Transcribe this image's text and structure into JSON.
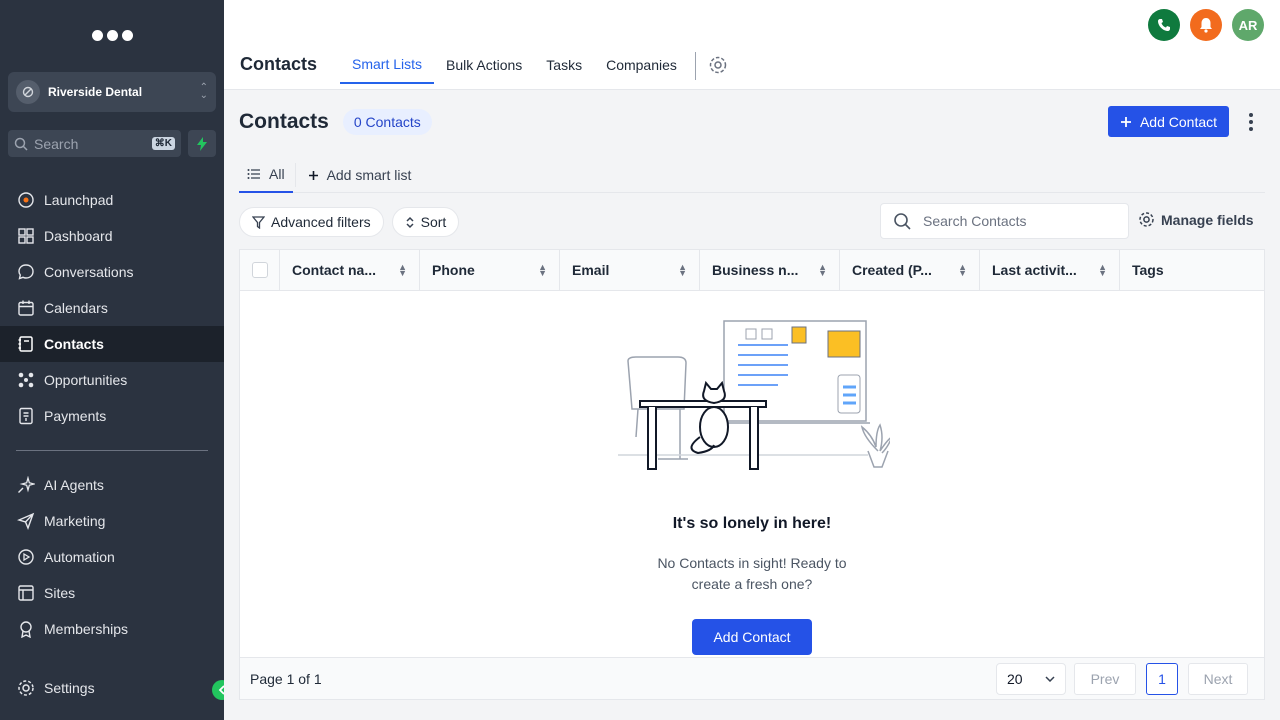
{
  "sidebar": {
    "account_name": "Riverside Dental",
    "search_placeholder": "Search",
    "search_shortcut": "⌘K",
    "items": [
      {
        "label": "Launchpad",
        "icon": "launchpad-icon"
      },
      {
        "label": "Dashboard",
        "icon": "dashboard-icon"
      },
      {
        "label": "Conversations",
        "icon": "chat-icon"
      },
      {
        "label": "Calendars",
        "icon": "calendar-icon"
      },
      {
        "label": "Contacts",
        "icon": "contacts-icon",
        "active": true
      },
      {
        "label": "Opportunities",
        "icon": "opportunities-icon"
      },
      {
        "label": "Payments",
        "icon": "payments-icon"
      }
    ],
    "items2": [
      {
        "label": "AI Agents",
        "icon": "sparkle-icon"
      },
      {
        "label": "Marketing",
        "icon": "send-icon"
      },
      {
        "label": "Automation",
        "icon": "automation-icon"
      },
      {
        "label": "Sites",
        "icon": "sites-icon"
      },
      {
        "label": "Memberships",
        "icon": "award-icon"
      }
    ],
    "settings_label": "Settings"
  },
  "header": {
    "title": "Contacts",
    "tabs": [
      {
        "label": "Smart Lists",
        "active": true
      },
      {
        "label": "Bulk Actions"
      },
      {
        "label": "Tasks"
      },
      {
        "label": "Companies"
      }
    ],
    "avatar_initials": "AR",
    "colors": {
      "phone": "#0f7a3e",
      "bell": "#f26b1d",
      "avatar": "#5fa86b"
    }
  },
  "page": {
    "title": "Contacts",
    "count_badge": "0 Contacts",
    "add_contact_label": "Add Contact",
    "smart_tabs": {
      "all": "All",
      "add": "Add smart list"
    },
    "filters": {
      "advanced": "Advanced filters",
      "sort": "Sort"
    },
    "search_placeholder": "Search Contacts",
    "manage_fields": "Manage fields",
    "columns": [
      "Contact na...",
      "Phone",
      "Email",
      "Business n...",
      "Created (P...",
      "Last activit...",
      "Tags"
    ],
    "empty": {
      "title": "It's so lonely in here!",
      "subtitle": "No Contacts in sight! Ready to create a fresh one?",
      "button": "Add Contact"
    },
    "pagination": {
      "page_text": "Page 1 of 1",
      "per_page": "20",
      "prev": "Prev",
      "current": "1",
      "next": "Next"
    }
  },
  "colors": {
    "accent": "#2552e7",
    "sidebar_bg": "#2b3340",
    "active_tab": "#2563eb"
  }
}
